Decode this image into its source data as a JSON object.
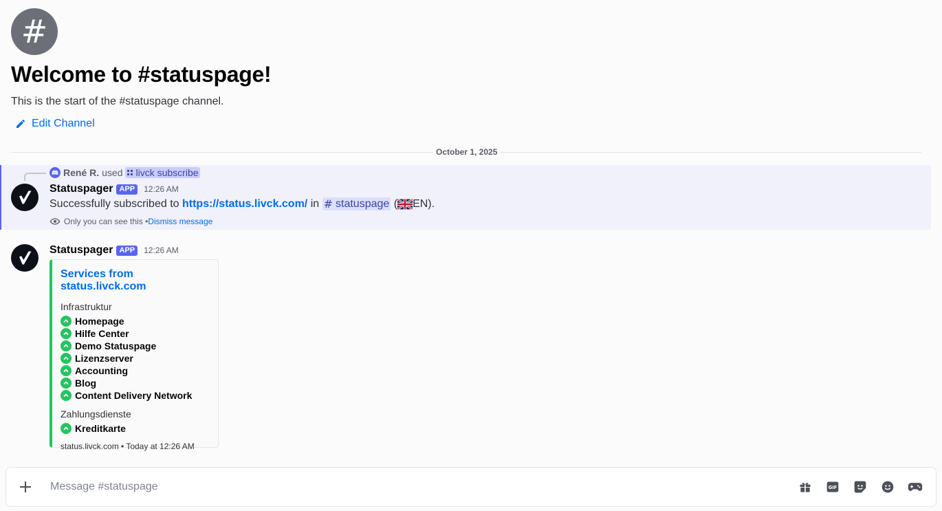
{
  "welcome": {
    "hash_symbol": "#",
    "title": "Welcome to #statuspage!",
    "subtitle": "This is the start of the #statuspage channel.",
    "edit_label": "Edit Channel"
  },
  "date_divider": "October 1, 2025",
  "message1": {
    "reply_user": "René R.",
    "reply_used": "used",
    "command": "livck subscribe",
    "username": "Statuspager",
    "badge": "APP",
    "time": "12:26 AM",
    "text_prefix": "Successfully subscribed to ",
    "link": "https://status.livck.com/",
    "text_in": " in ",
    "channel": "statuspage",
    "lang_open": " (",
    "lang": "EN).",
    "ephemeral_text": "Only you can see this",
    "ephemeral_sep": " • ",
    "dismiss": "Dismiss message"
  },
  "message2": {
    "username": "Statuspager",
    "badge": "APP",
    "time": "12:26 AM",
    "embed": {
      "title": "Services from status.livck.com",
      "sections": [
        {
          "name": "Infrastruktur",
          "services": [
            "Homepage",
            "Hilfe Center",
            "Demo Statuspage",
            "Lizenzserver",
            "Accounting",
            "Blog",
            "Content Delivery Network"
          ]
        },
        {
          "name": "Zahlungsdienste",
          "services": [
            "Kreditkarte"
          ]
        }
      ],
      "footer": "status.livck.com • Today at 12:26 AM",
      "accent_color": "#23c55e"
    }
  },
  "composer": {
    "placeholder": "Message #statuspage"
  },
  "colors": {
    "blurple": "#5865f2",
    "link": "#006ce7",
    "status_up": "#23c55e"
  }
}
